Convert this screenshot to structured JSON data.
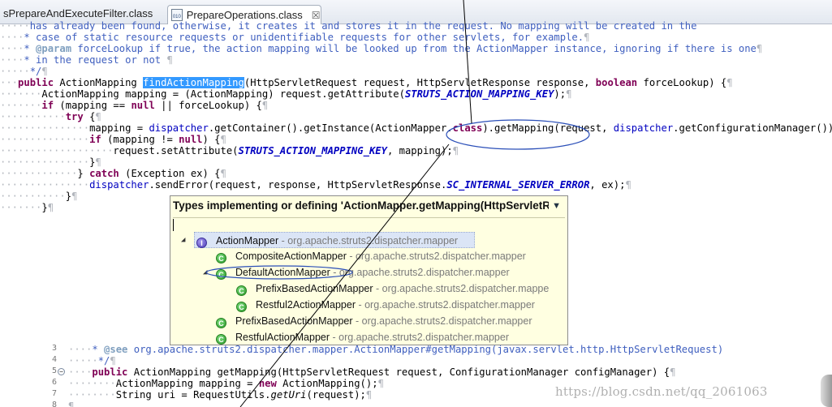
{
  "tabs": [
    {
      "label": "sPrepareAndExecuteFilter.class",
      "active": false
    },
    {
      "label": "PrepareOperations.class",
      "active": true,
      "close": "☒"
    }
  ],
  "code_top": {
    "l1": "has already been found, otherwise, it creates it and stores it in the request. No mapping will be created in the",
    "l2_pre": "case of static resource requests or unidentifiable requests for other servlets, for example.",
    "l3_tag": "@param",
    "l3_rest": " forceLookup if true, the action mapping will be looked up from the ActionMapper instance, ignoring if there is one",
    "l4": "in the request or not",
    "l5": "*/",
    "sig_kw": "public",
    "sig_type": " ActionMapping ",
    "sig_method": "findActionMapping",
    "sig_rest1": "(HttpServletRequest request, HttpServletResponse response, ",
    "sig_bool": "boolean",
    "sig_rest2": " forceLookup) {",
    "m1_a": "ActionMapping mapping = (ActionMapping) request.getAttribute(",
    "m1_const": "STRUTS_ACTION_MAPPING_KEY",
    "m1_b": ");",
    "if1_kw": "if",
    "if1_a": " (mapping == ",
    "null": "null",
    "if1_b": " || forceLookup) {",
    "try": "try",
    "try_b": " {",
    "m2_a": "mapping = ",
    "m2_field": "dispatcher",
    "m2_b": ".getContainer().getInstance(ActionMapper.",
    "class_kw": "class",
    "m2_c": ").getMapping(request, ",
    "m2_d": ".getConfigurationManager());",
    "if2_a": " (mapping != ",
    "if2_b": ") {",
    "set_a": "request.setAttribute(",
    "set_b": ", mapping);",
    "close1": "}",
    "catch_pre": "} ",
    "catch_kw": "catch",
    "catch_rest": " (Exception ex) {",
    "err_b": ".sendError(request, response, HttpServletResponse.",
    "err_const": "SC_INTERNAL_SERVER_ERROR",
    "err_c": ", ex);",
    "close2": "}",
    "close3": "}",
    "pilcrow": "¶"
  },
  "popup": {
    "title": "Types implementing or defining 'ActionMapper.getMapping(HttpServletRe",
    "menu_arrow": "▼",
    "rows": [
      {
        "name": "ActionMapper",
        "pkg": " - org.apache.struts2.dispatcher.mapper",
        "icon": "I",
        "toggle": "◢"
      },
      {
        "name": "CompositeActionMapper",
        "pkg": " - org.apache.struts2.dispatcher.mapper",
        "icon": "C"
      },
      {
        "name": "DefaultActionMapper",
        "pkg": " - org.apache.struts2.dispatcher.mapper",
        "icon": "C",
        "toggle": "◢"
      },
      {
        "name": "PrefixBasedActionMapper",
        "pkg": " - org.apache.struts2.dispatcher.mappe",
        "icon": "C"
      },
      {
        "name": "Restful2ActionMapper",
        "pkg": " - org.apache.struts2.dispatcher.mapper",
        "icon": "C"
      },
      {
        "name": "PrefixBasedActionMapper",
        "pkg": " - org.apache.struts2.dispatcher.mapper",
        "icon": "C"
      },
      {
        "name": "RestfulActionMapper",
        "pkg": " - org.apache.struts2.dispatcher.mapper",
        "icon": "C"
      }
    ]
  },
  "code_bottom": {
    "ln1": "3",
    "ln2": "4",
    "ln3": "5",
    "ln4": "6",
    "ln5": "7",
    "ln6": "8",
    "see_tag": "@see",
    "see_rest": " org.apache.struts2.dispatcher.mapper.ActionMapper#getMapping(javax.servlet.http.HttpServletRequest)",
    "end": "*/",
    "sig_kw": "public",
    "sig_rest": " ActionMapping getMapping(HttpServletRequest request, ConfigurationManager configManager) {",
    "m1_a": "ActionMapping mapping = ",
    "new_kw": "new",
    "m1_b": " ActionMapping();",
    "m2_a": "String uri = RequestUtils.",
    "m2_i": "getUri",
    "m2_b": "(request);",
    "fold": "−"
  },
  "watermark": "https://blog.csdn.net/qq_2061063"
}
